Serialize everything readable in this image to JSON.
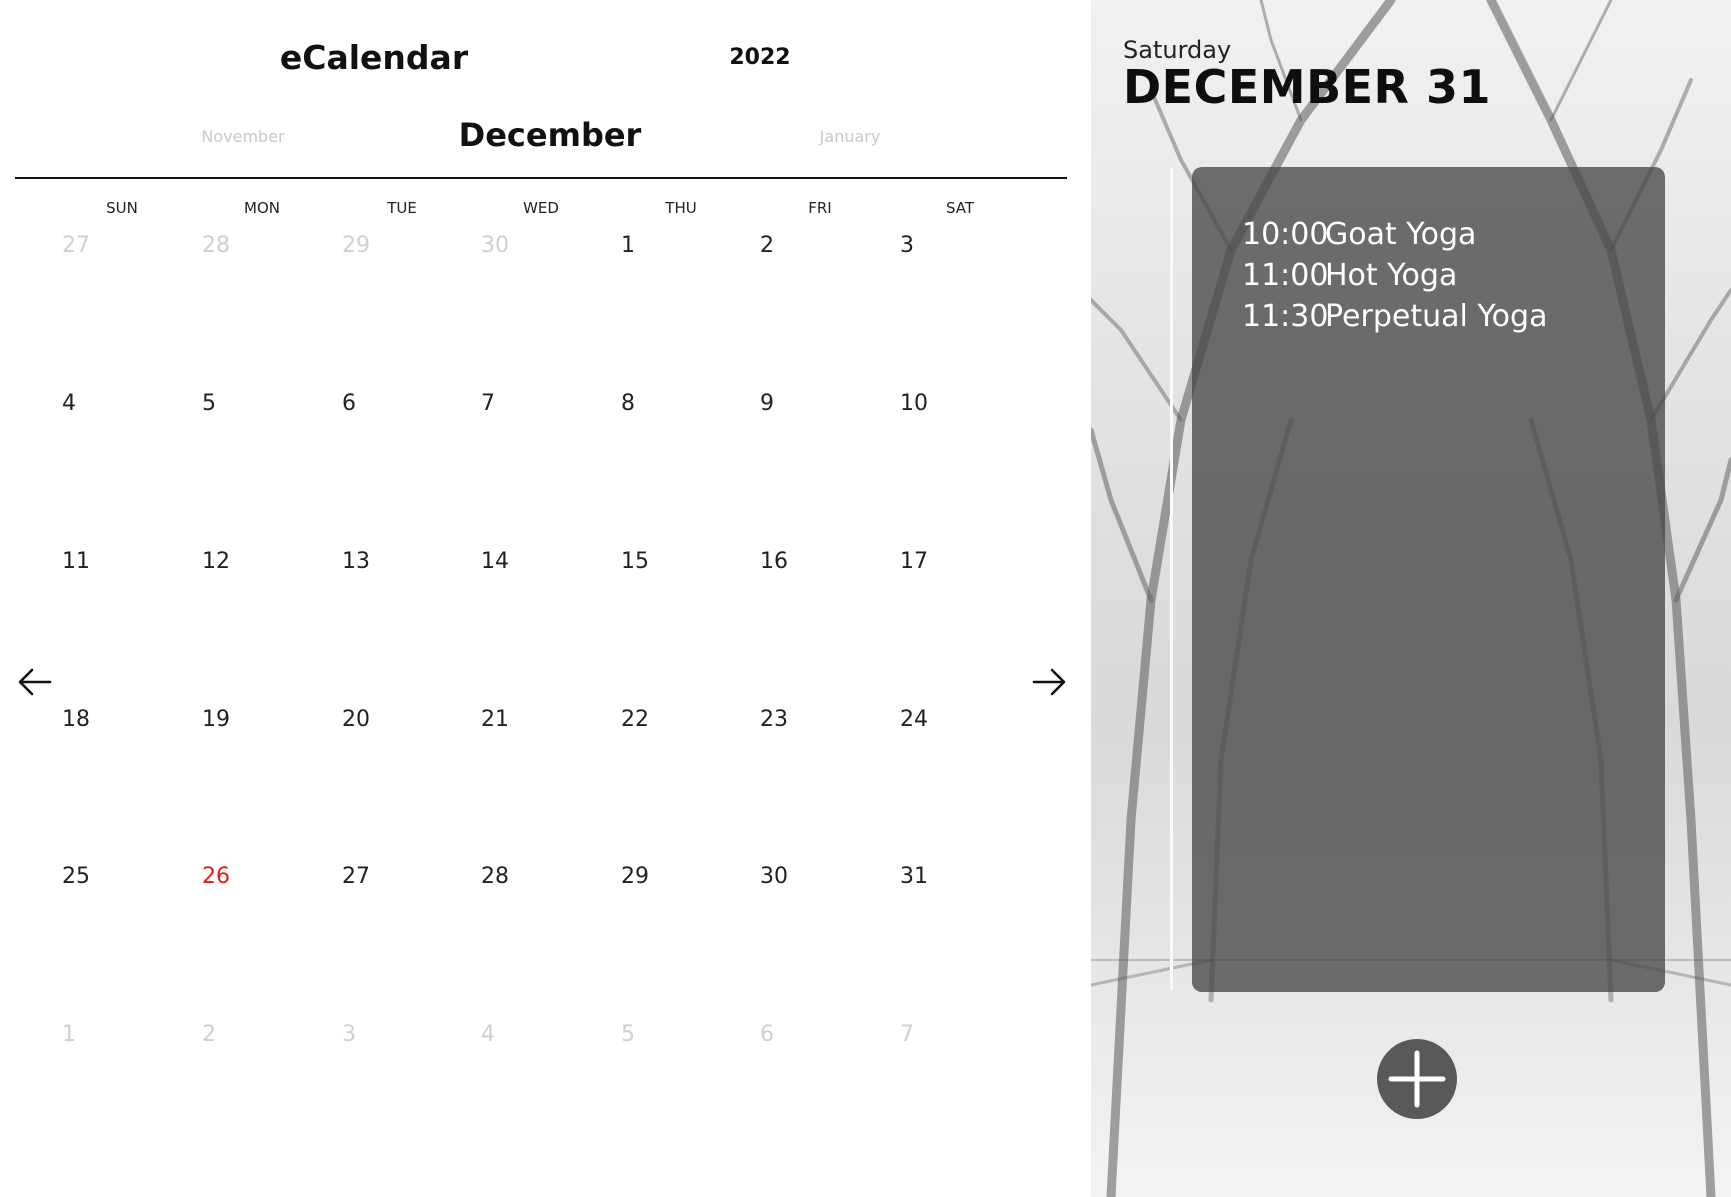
{
  "header": {
    "app_title": "eCalendar",
    "year": "2022"
  },
  "months": {
    "previous": "November",
    "current": "December",
    "next": "January"
  },
  "weekdays": [
    "SUN",
    "MON",
    "TUE",
    "WED",
    "THU",
    "FRI",
    "SAT"
  ],
  "weeks": [
    [
      "27",
      "28",
      "29",
      "30",
      "1",
      "2",
      "3"
    ],
    [
      "4",
      "5",
      "6",
      "7",
      "8",
      "9",
      "10"
    ],
    [
      "11",
      "12",
      "13",
      "14",
      "15",
      "16",
      "17"
    ],
    [
      "18",
      "19",
      "20",
      "21",
      "22",
      "23",
      "24"
    ],
    [
      "25",
      "26",
      "27",
      "28",
      "29",
      "30",
      "31"
    ],
    [
      "1",
      "2",
      "3",
      "4",
      "5",
      "6",
      "7"
    ]
  ],
  "icons": {
    "prev_month": "arrow-left-icon",
    "next_month": "arrow-right-icon",
    "add_event": "plus-icon"
  },
  "colors": {
    "today": "#e41d1d",
    "outside_month_day": "#cfcfcf",
    "panel": "#484848"
  },
  "agenda": {
    "weekday": "Saturday",
    "date": "DECEMBER 31",
    "events": [
      {
        "time": "10:00",
        "title": "Goat Yoga"
      },
      {
        "time": "11:00",
        "title": "Hot Yoga"
      },
      {
        "time": "11:30",
        "title": "Perpetual Yoga"
      }
    ]
  }
}
